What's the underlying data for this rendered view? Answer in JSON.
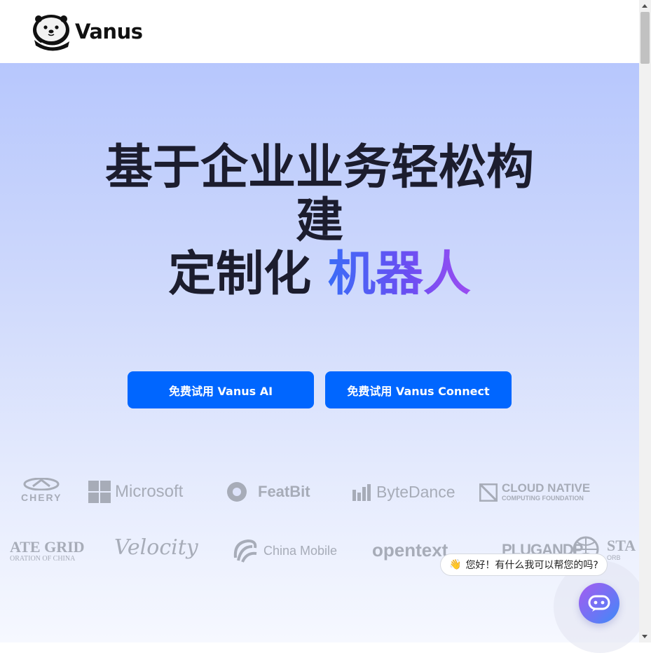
{
  "header": {
    "brand": "Vanus",
    "logo_icon": "otter-icon"
  },
  "hero": {
    "headline_line1": "基于企业业务轻松构建",
    "headline_line2_prefix": "定制化 ",
    "headline_line2_accent": "机器人",
    "accent_gradient": [
      "#3b6cf7",
      "#9b4df1"
    ],
    "cta_ai": "免费试用 Vanus AI",
    "cta_connect": "免费试用 Vanus Connect",
    "cta_color": "#0066ff"
  },
  "logos_row1": [
    {
      "name": "CHERY",
      "text": "CHERY"
    },
    {
      "name": "Microsoft",
      "text": "Microsoft"
    },
    {
      "name": "FeatBit",
      "text": "FeatBit"
    },
    {
      "name": "ByteDance",
      "text": "ByteDance"
    },
    {
      "name": "CLOUD NATIVE",
      "text": "CLOUD NATIVE",
      "sub": "COMPUTING FOUNDATION"
    }
  ],
  "logos_row2": [
    {
      "name": "STATE GRID",
      "text": "ATE GRID",
      "sub": "ORATION OF CHINA"
    },
    {
      "name": "Velocity",
      "text": "Velocity"
    },
    {
      "name": "China Mobile",
      "text": "China Mobile"
    },
    {
      "name": "opentext",
      "text": "opentext"
    },
    {
      "name": "PLUGANDPLAY",
      "text": "PLUGANDP"
    },
    {
      "name": "STA",
      "text": "STA",
      "sub": "ORB"
    }
  ],
  "chat": {
    "greeting_emoji": "👋",
    "greeting": "您好！有什么我可以帮您的吗?",
    "button_icon": "chat-bot-icon"
  }
}
